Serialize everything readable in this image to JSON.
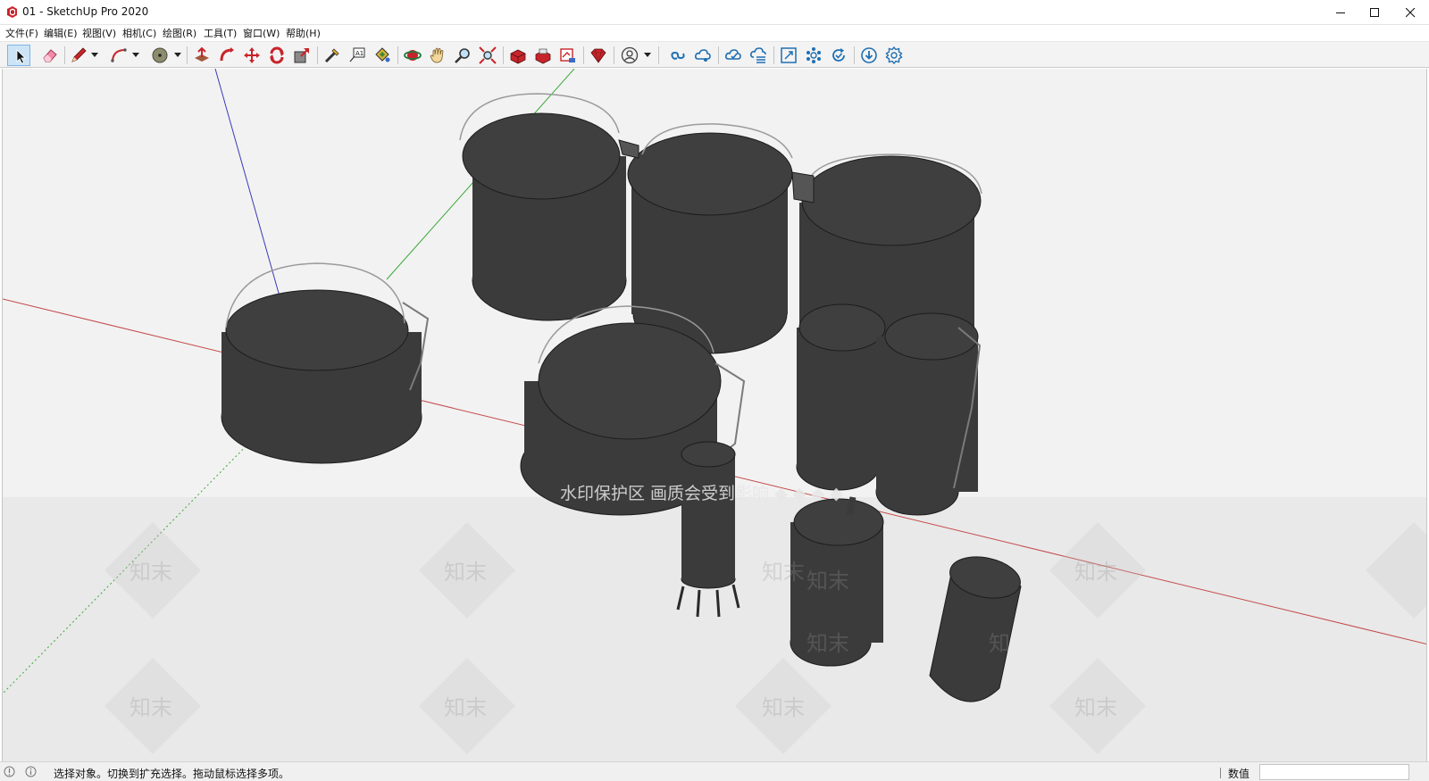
{
  "window": {
    "title": "01 - SketchUp Pro 2020",
    "controls": [
      "minimize-icon",
      "maximize-icon",
      "close-icon"
    ]
  },
  "menu": [
    {
      "label": "文件(F)"
    },
    {
      "label": "编辑(E)"
    },
    {
      "label": "视图(V)"
    },
    {
      "label": "相机(C)"
    },
    {
      "label": "绘图(R)"
    },
    {
      "label": "工具(T)"
    },
    {
      "label": "窗口(W)"
    },
    {
      "label": "帮助(H)"
    }
  ],
  "toolbar": {
    "active_tool": "select-tool",
    "tools": [
      "select-tool",
      "eraser-tool",
      "pencil-line-tool",
      "arc-tool",
      "shape-circle-tool",
      "push-pull-tool",
      "follow-me-tool",
      "move-tool",
      "rotate-tool",
      "scale-tool",
      "tape-measure-tool",
      "text-tool",
      "paint-bucket-tool",
      "orbit-tool",
      "pan-tool",
      "zoom-tool",
      "zoom-extents-tool",
      "3d-warehouse-icon",
      "extension-warehouse-icon",
      "layout-send-icon",
      "extension-manager-icon",
      "account-icon",
      "trimble-connect-icon",
      "trimble-share-icon",
      "cloud-sync-icon",
      "cloud-publish-icon",
      "collaboration-view-icon",
      "model-network-icon",
      "refresh-cycle-icon",
      "download-icon",
      "settings-gear-icon"
    ]
  },
  "viewport": {
    "watermark_banner": "水印保护区  画质会受到影响  ◆ ◆ ◆ ◆",
    "watermark_tile": "知末",
    "axis_colors": {
      "red": "#c44a4a",
      "green": "#3aa83a",
      "blue": "#3a3ab8"
    },
    "model_fill": "#3b3b3b",
    "background": "#f2f2f2"
  },
  "status": {
    "message": "选择对象。切换到扩充选择。拖动鼠标选择多项。",
    "measurement_label": "数值",
    "measurement_value": ""
  }
}
